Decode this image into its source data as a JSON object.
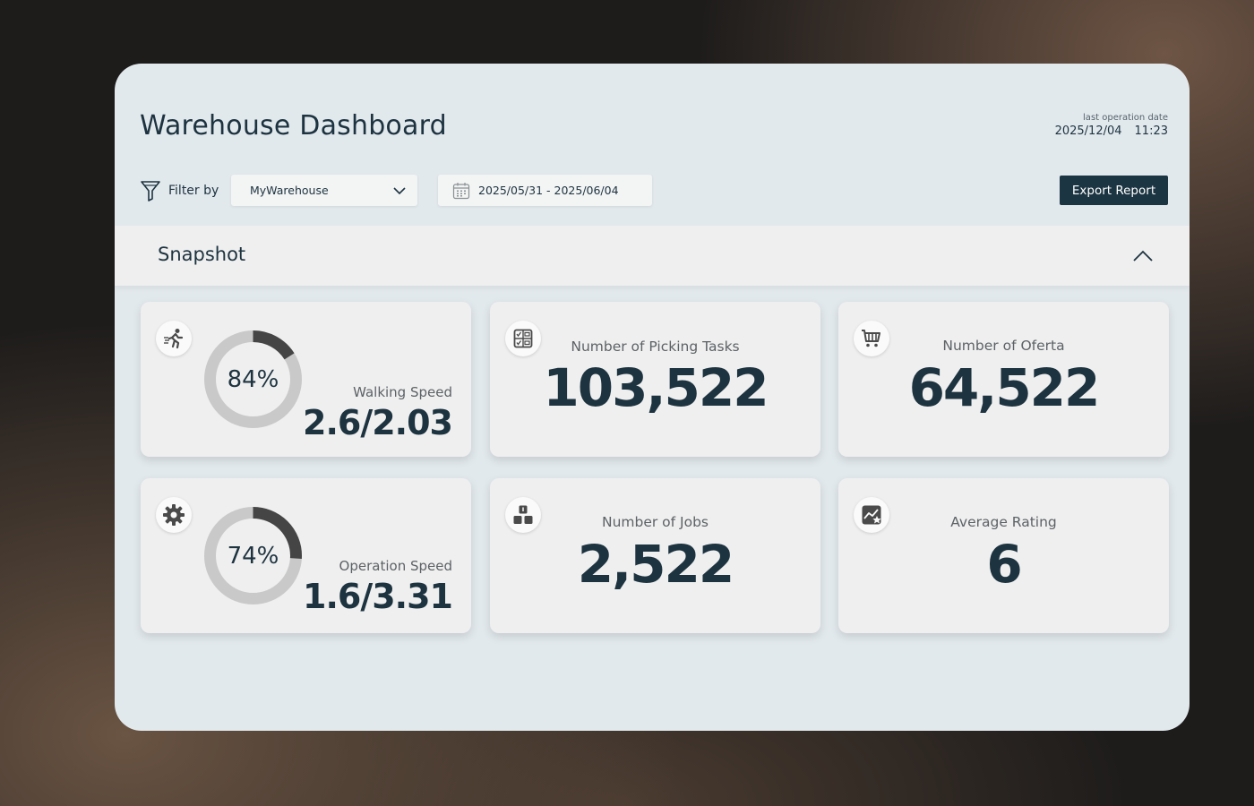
{
  "header": {
    "title": "Warehouse Dashboard",
    "last_operation_label": "last operation date",
    "last_operation_date": "2025/12/04",
    "last_operation_time": "11:23"
  },
  "filters": {
    "filter_label": "Filter by",
    "warehouse_value": "MyWarehouse",
    "date_range": "2025/05/31 - 2025/06/04",
    "export_label": "Export Report"
  },
  "snapshot": {
    "title": "Snapshot"
  },
  "cards": {
    "walking": {
      "icon": "running-person-icon",
      "percent": 0.84,
      "percent_label": "84%",
      "label": "Walking Speed",
      "value": "2.6/2.03"
    },
    "picking": {
      "icon": "checklist-icon",
      "label": "Number of Picking Tasks",
      "value": "103,522"
    },
    "oferta": {
      "icon": "shopping-cart-icon",
      "label": "Number of Oferta",
      "value": "64,522"
    },
    "operation": {
      "icon": "gear-icon",
      "percent": 0.74,
      "percent_label": "74%",
      "label": "Operation Speed",
      "value": "1.6/3.31"
    },
    "jobs": {
      "icon": "boxes-icon",
      "label": "Number of Jobs",
      "value": "2,522"
    },
    "rating": {
      "icon": "rating-chart-icon",
      "label": "Average Rating",
      "value": "6"
    }
  },
  "colors": {
    "primary": "#1c3542",
    "panel_bg": "#e2e9ed",
    "card_bg": "#efefef",
    "gauge_dark": "#454545",
    "gauge_light": "#c9c9c9"
  }
}
